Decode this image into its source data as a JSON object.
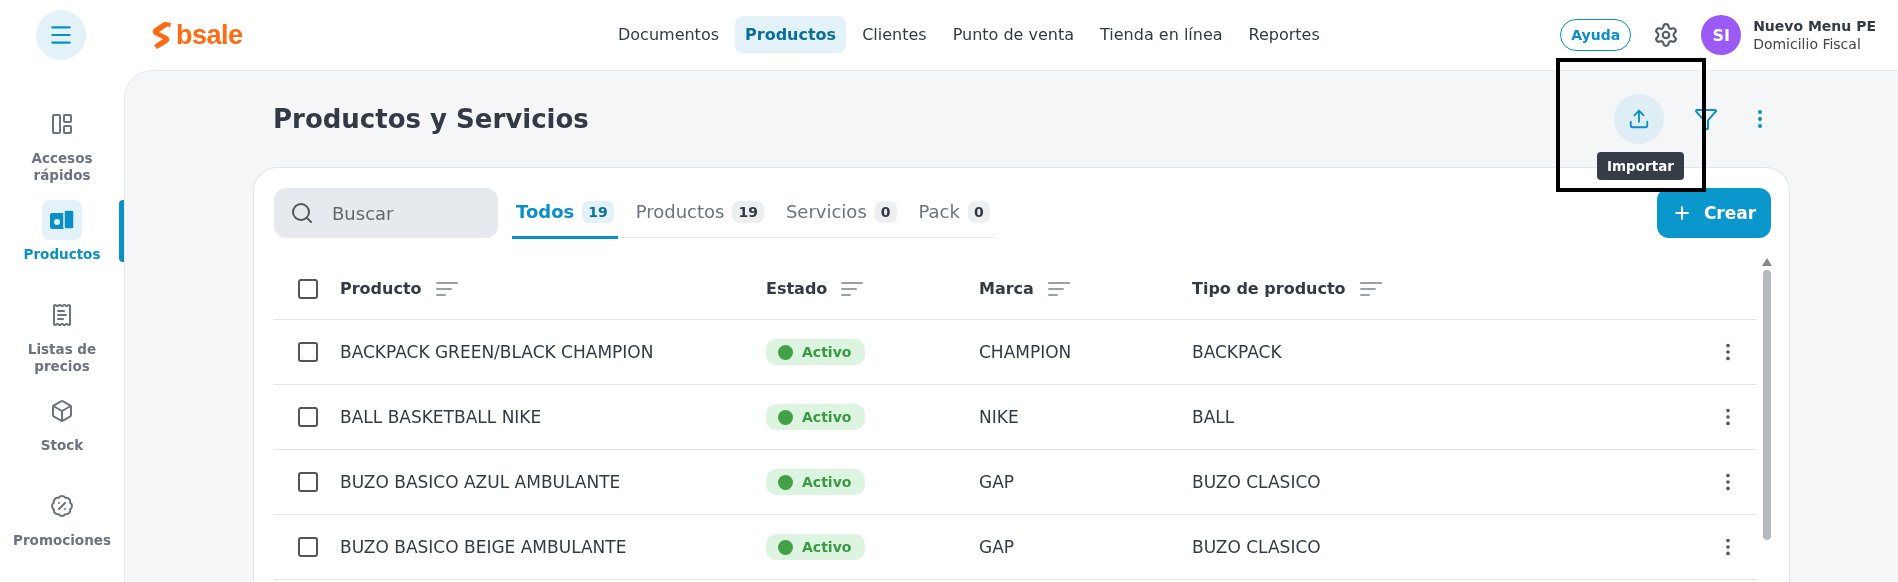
{
  "header": {
    "logo": "bsale",
    "nav": [
      {
        "label": "Documentos",
        "selected": false
      },
      {
        "label": "Productos",
        "selected": true
      },
      {
        "label": "Clientes",
        "selected": false
      },
      {
        "label": "Punto de venta",
        "selected": false
      },
      {
        "label": "Tienda en línea",
        "selected": false
      },
      {
        "label": "Reportes",
        "selected": false
      }
    ],
    "help": "Ayuda",
    "avatar": "SI",
    "account_name": "Nuevo Menu PE",
    "account_subtitle": "Domicilio Fiscal"
  },
  "sidebar": {
    "items": [
      {
        "label": "Accesos rápidos",
        "selected": false
      },
      {
        "label": "Productos",
        "selected": true
      },
      {
        "label": "Listas de precios",
        "selected": false
      },
      {
        "label": "Stock",
        "selected": false
      },
      {
        "label": "Promociones",
        "selected": false
      }
    ]
  },
  "page": {
    "title": "Productos y Servicios",
    "tooltip": "Importar"
  },
  "toolbar": {
    "search": {
      "placeholder": "Buscar"
    },
    "tabs": [
      {
        "label": "Todos",
        "count": "19",
        "selected": true
      },
      {
        "label": "Productos",
        "count": "19",
        "selected": false
      },
      {
        "label": "Servicios",
        "count": "0",
        "selected": false
      },
      {
        "label": "Pack",
        "count": "0",
        "selected": false
      }
    ],
    "create_button": "Crear"
  },
  "table": {
    "all_checked": false,
    "columns": [
      "Producto",
      "Estado",
      "Marca",
      "Tipo de producto"
    ],
    "rows": [
      {
        "checked": false,
        "product": "BACKPACK GREEN/BLACK CHAMPION",
        "status": "Activo",
        "brand": "CHAMPION",
        "type": "BACKPACK"
      },
      {
        "checked": false,
        "product": "BALL BASKETBALL NIKE",
        "status": "Activo",
        "brand": "NIKE",
        "type": "BALL"
      },
      {
        "checked": false,
        "product": "BUZO BASICO AZUL AMBULANTE",
        "status": "Activo",
        "brand": "GAP",
        "type": "BUZO CLASICO"
      },
      {
        "checked": false,
        "product": "BUZO BASICO BEIGE AMBULANTE",
        "status": "Activo",
        "brand": "GAP",
        "type": "BUZO CLASICO"
      }
    ]
  }
}
